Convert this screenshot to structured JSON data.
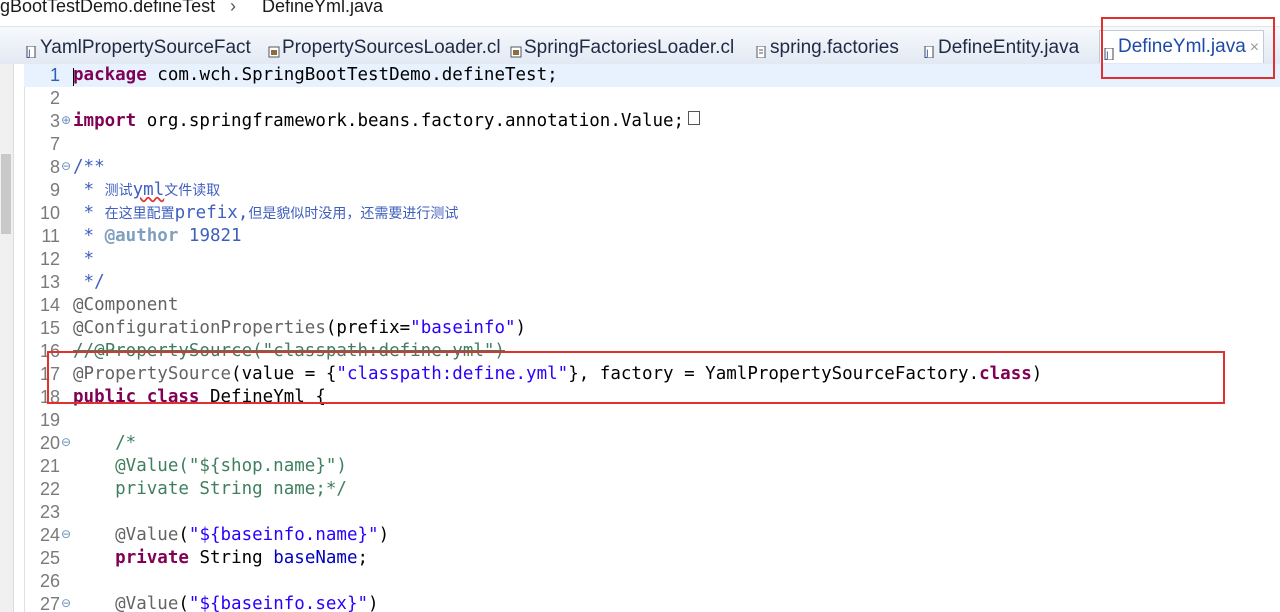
{
  "breadcrumb": {
    "segment1": "gBootTestDemo.defineTest",
    "separator": "›",
    "segment2": "DefineYml.java"
  },
  "tabs": [
    {
      "label": "YamlPropertySourceFact",
      "icon": "java-class-icon"
    },
    {
      "label": "PropertySourcesLoader.cl",
      "icon": "class-file-icon"
    },
    {
      "label": "SpringFactoriesLoader.cl",
      "icon": "class-file-icon"
    },
    {
      "label": "spring.factories",
      "icon": "text-file-icon"
    },
    {
      "label": "DefineEntity.java",
      "icon": "java-file-icon"
    },
    {
      "label": "DefineYml.java",
      "icon": "java-file-icon",
      "active": true,
      "close": "×"
    }
  ],
  "editor": {
    "line_numbers": [
      "1",
      "2",
      "3",
      "7",
      "8",
      "9",
      "10",
      "11",
      "12",
      "13",
      "14",
      "15",
      "16",
      "17",
      "18",
      "19",
      "20",
      "21",
      "22",
      "23",
      "24",
      "25",
      "26",
      "27"
    ],
    "lines": {
      "l1": {
        "kw": "package",
        "rest": " com.wch.SpringBootTestDemo.defineTest;"
      },
      "l3": {
        "kw": "import",
        "rest": " org.springframework.beans.factory.annotation.Value;"
      },
      "l8": "/**",
      "l9": {
        "star": " * ",
        "cn1": "测试",
        "yml": "yml",
        "cn2": "文件读取"
      },
      "l10": {
        "star": " * ",
        "cn1": "在这里配置",
        "prefix": "prefix,",
        "cn2": "但是貌似时没用，还需要进行测试"
      },
      "l11": {
        "star": " * ",
        "tag": "@author",
        "rest": " 19821"
      },
      "l12": " *",
      "l13": " */",
      "l14": "@Component",
      "l15": {
        "ann": "@ConfigurationProperties",
        "p1": "(prefix=",
        "str": "\"baseinfo\"",
        "p2": ")"
      },
      "l16": "//@PropertySource(\"classpath:define.yml\")",
      "l17": {
        "ann": "@PropertySource",
        "p1": "(value = {",
        "str": "\"classpath:define.yml\"",
        "p2": "}, factory = YamlPropertySourceFactory.",
        "kw": "class",
        "p3": ")"
      },
      "l18": {
        "kw1": "public",
        "kw2": "class",
        "rest": " DefineYml {"
      },
      "l20": "    /*",
      "l21": "    @Value(\"${shop.name}\")",
      "l22": "    private String name;*/",
      "l24": {
        "ann": "    @Value",
        "p1": "(",
        "str": "\"${baseinfo.name}\"",
        "p2": ")"
      },
      "l25": {
        "indent": "    ",
        "kw": "private",
        "type": " String ",
        "field": "baseName",
        "semi": ";"
      },
      "l27": {
        "ann": "    @Value",
        "p1": "(",
        "str": "\"${baseinfo.sex}\"",
        "p2": ")"
      }
    }
  },
  "colors": {
    "keyword": "#7f0055",
    "string": "#2a00ff",
    "comment": "#3f7f5f",
    "javadoc": "#3f5fbf",
    "annotation": "#646464",
    "highlight": "#e03030"
  }
}
